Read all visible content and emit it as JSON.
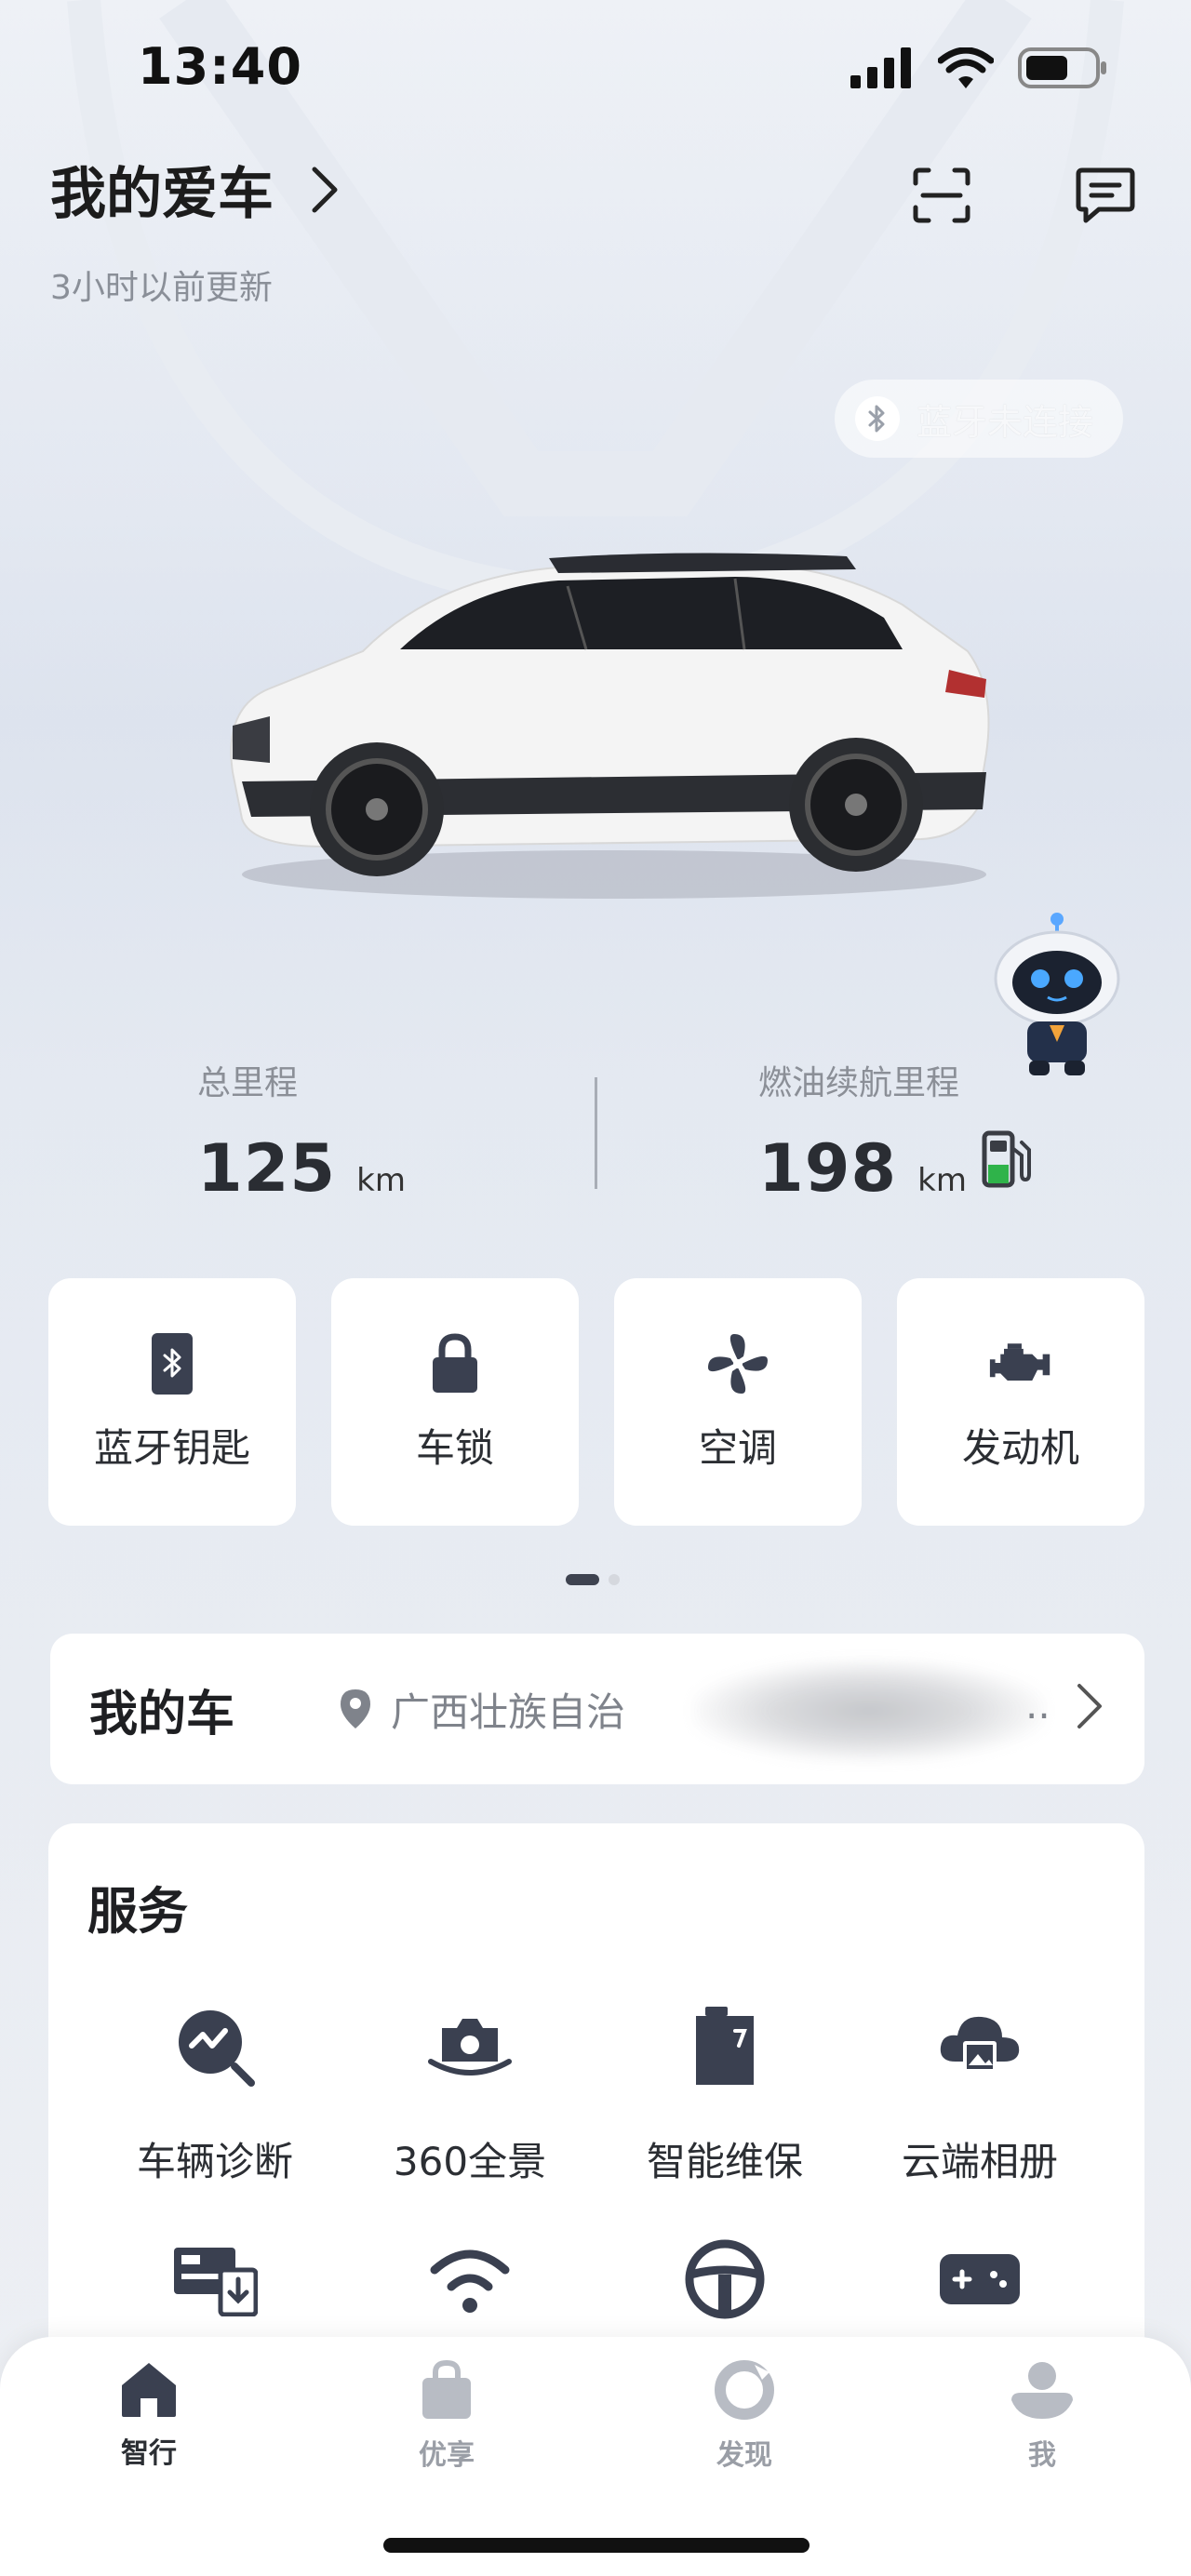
{
  "status_bar": {
    "time": "13:40"
  },
  "header": {
    "title": "我的爱车",
    "updated": "3小时以前更新"
  },
  "bluetooth_status": "蓝牙未连接",
  "stats": {
    "total_mileage": {
      "label": "总里程",
      "value": "125",
      "unit": "km"
    },
    "fuel_range": {
      "label": "燃油续航里程",
      "value": "198",
      "unit": "km"
    }
  },
  "controls": [
    {
      "label": "蓝牙钥匙",
      "icon": "bluetooth-key-icon"
    },
    {
      "label": "车锁",
      "icon": "lock-icon"
    },
    {
      "label": "空调",
      "icon": "fan-icon"
    },
    {
      "label": "发动机",
      "icon": "engine-icon"
    }
  ],
  "pager": {
    "pages": 2,
    "current": 1
  },
  "my_car": {
    "title": "我的车",
    "location": "广西壮族自治",
    "ellipsis": ".."
  },
  "services": {
    "title": "服务",
    "items": [
      {
        "label": "车辆诊断",
        "icon": "diagnosis-icon"
      },
      {
        "label": "360全景",
        "icon": "panorama-camera-icon"
      },
      {
        "label": "智能维保",
        "icon": "maintenance-icon"
      },
      {
        "label": "云端相册",
        "icon": "cloud-album-icon"
      },
      {
        "label": "",
        "icon": "dashcam-download-icon"
      },
      {
        "label": "",
        "icon": "wifi-icon"
      },
      {
        "label": "",
        "icon": "steering-wheel-icon"
      },
      {
        "label": "",
        "icon": "gamepad-icon"
      }
    ]
  },
  "tabs": [
    {
      "label": "智行",
      "icon": "home-icon",
      "active": true
    },
    {
      "label": "优享",
      "icon": "shopping-bag-icon",
      "active": false
    },
    {
      "label": "发现",
      "icon": "discover-icon",
      "active": false
    },
    {
      "label": "我",
      "icon": "profile-icon",
      "active": false
    }
  ],
  "colors": {
    "accent_dark": "#3a4050",
    "fuel_green": "#2fb34a",
    "text_secondary": "#8b8f97"
  }
}
